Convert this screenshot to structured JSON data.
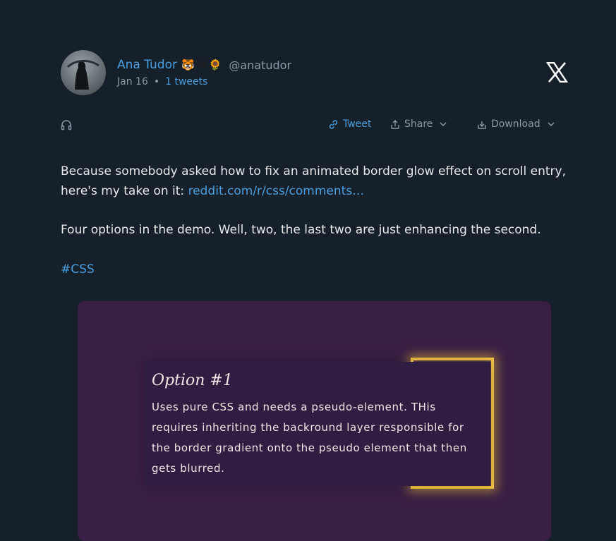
{
  "author": {
    "name": "Ana Tudor",
    "emoji_1": "🐯",
    "emoji_3": "🌻",
    "handle": "@anatudor",
    "date": "Jan 16",
    "tweets_link": "1 tweets"
  },
  "actions": {
    "tweet_label": "Tweet",
    "share_label": "Share",
    "download_label": "Download"
  },
  "post": {
    "p1_text": "Because somebody asked how to fix an animated border glow effect on scroll entry, here's my take on it: ",
    "p1_link": "reddit.com/r/css/comments…",
    "p2_text": "Four options in the demo. Well, two, the last two are just enhancing the second.",
    "hashtag": "#CSS"
  },
  "media": {
    "option_title": "Option #1",
    "option_body": "Uses pure CSS and needs a pseudo-element. THis requires inheriting the backround layer responsible for the border gradient onto the pseudo element that then gets blurred."
  },
  "colors": {
    "background": "#15202b",
    "link": "#4a9fe0",
    "muted": "#8b98a5",
    "media_bg": "#3a1f45",
    "glow": "#f4c542"
  },
  "icons": [
    "headphones-icon",
    "link-icon",
    "share-icon",
    "download-icon",
    "chevron-down-icon",
    "x-logo-icon"
  ]
}
